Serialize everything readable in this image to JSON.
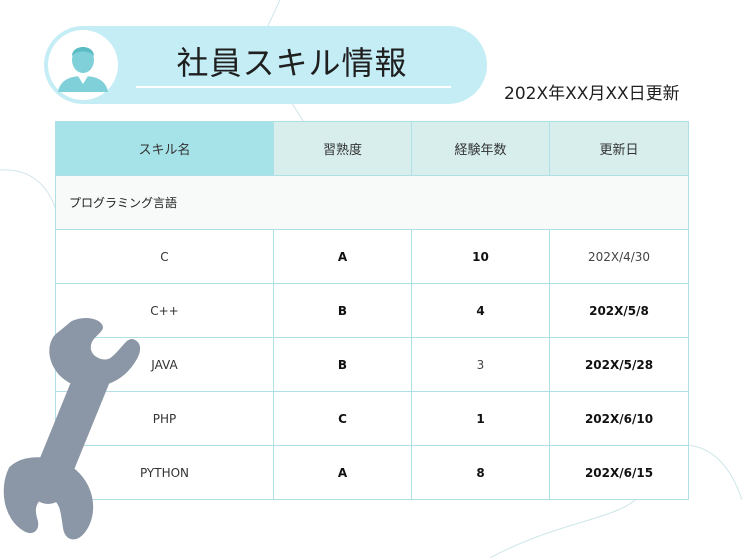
{
  "header": {
    "title": "社員スキル情報",
    "updated": "202X年XX月XX日更新"
  },
  "table": {
    "columns": [
      "スキル名",
      "習熟度",
      "経験年数",
      "更新日"
    ],
    "category": "プログラミング言語",
    "rows": [
      {
        "skill": "C",
        "level": "A",
        "years": "10",
        "date": "202X/4/30"
      },
      {
        "skill": "C++",
        "level": "B",
        "years": "4",
        "date": "202X/5/8"
      },
      {
        "skill": "JAVA",
        "level": "B",
        "years": "3",
        "date": "202X/5/28"
      },
      {
        "skill": "PHP",
        "level": "C",
        "years": "1",
        "date": "202X/6/10"
      },
      {
        "skill": "PYTHON",
        "level": "A",
        "years": "8",
        "date": "202X/6/15"
      }
    ]
  },
  "icons": {
    "avatar": "person-avatar-icon",
    "wrench": "wrench-icon"
  },
  "colors": {
    "pill": "#c4edf6",
    "header_name": "#a6e3e8",
    "header_other": "#d7eeec",
    "border": "#aee0e6",
    "avatar": "#7fd0d8",
    "wrench": "#8b97a6"
  }
}
